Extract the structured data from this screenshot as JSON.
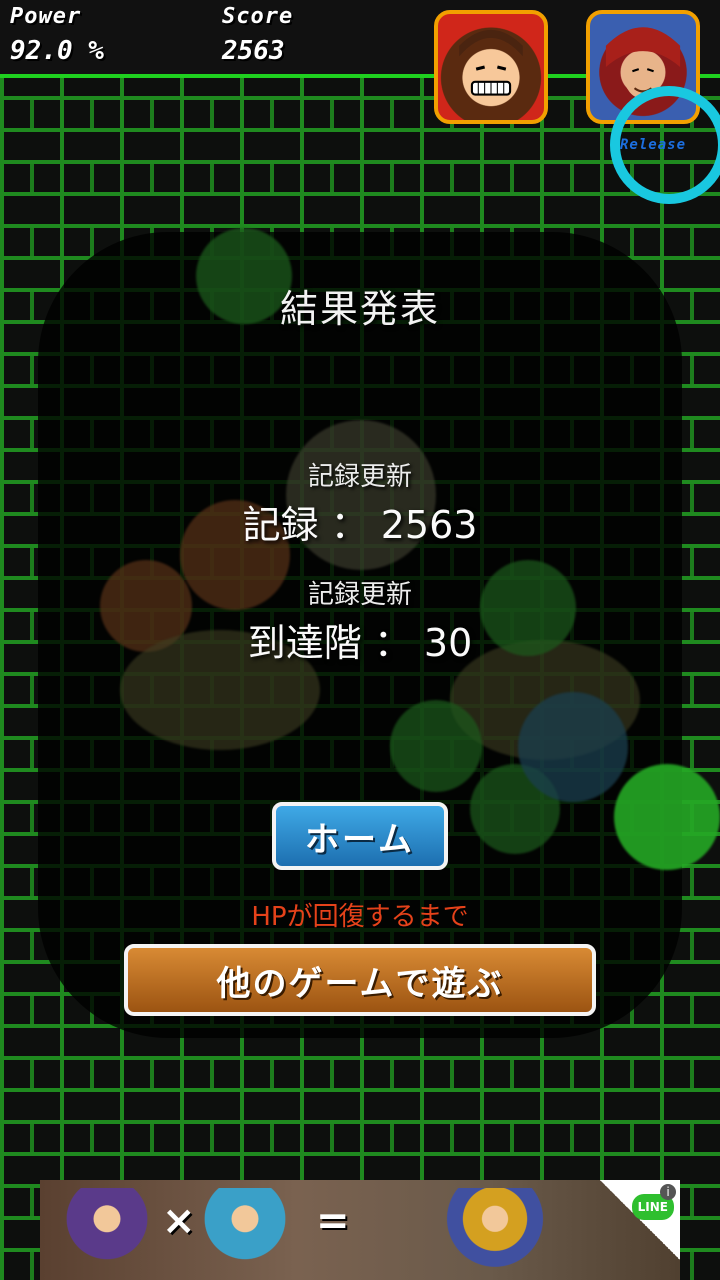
{
  "hud": {
    "power_label": "Power",
    "power_value": "92.0 %",
    "score_label": "Score",
    "score_value": "2563",
    "release_label": "Release"
  },
  "result": {
    "title": "結果発表",
    "record_badge": "記録更新",
    "record_line": "記録 ： 2563",
    "floor_badge": "記録更新",
    "floor_line": "到達階 ： 30"
  },
  "buttons": {
    "home": "ホーム",
    "hp_notice": "HPが回復するまで",
    "other_games": "他のゲームで遊ぶ"
  },
  "ad": {
    "times": "×",
    "equals": "=",
    "line_badge": "LINE",
    "info": "i"
  },
  "colors": {
    "brick": "#1f8a1f",
    "hud_border": "#1fd11f",
    "release_ring": "#19c8e0",
    "home_button": "#2b8fd0",
    "games_button": "#c07428",
    "hp_text": "#e5421a"
  }
}
